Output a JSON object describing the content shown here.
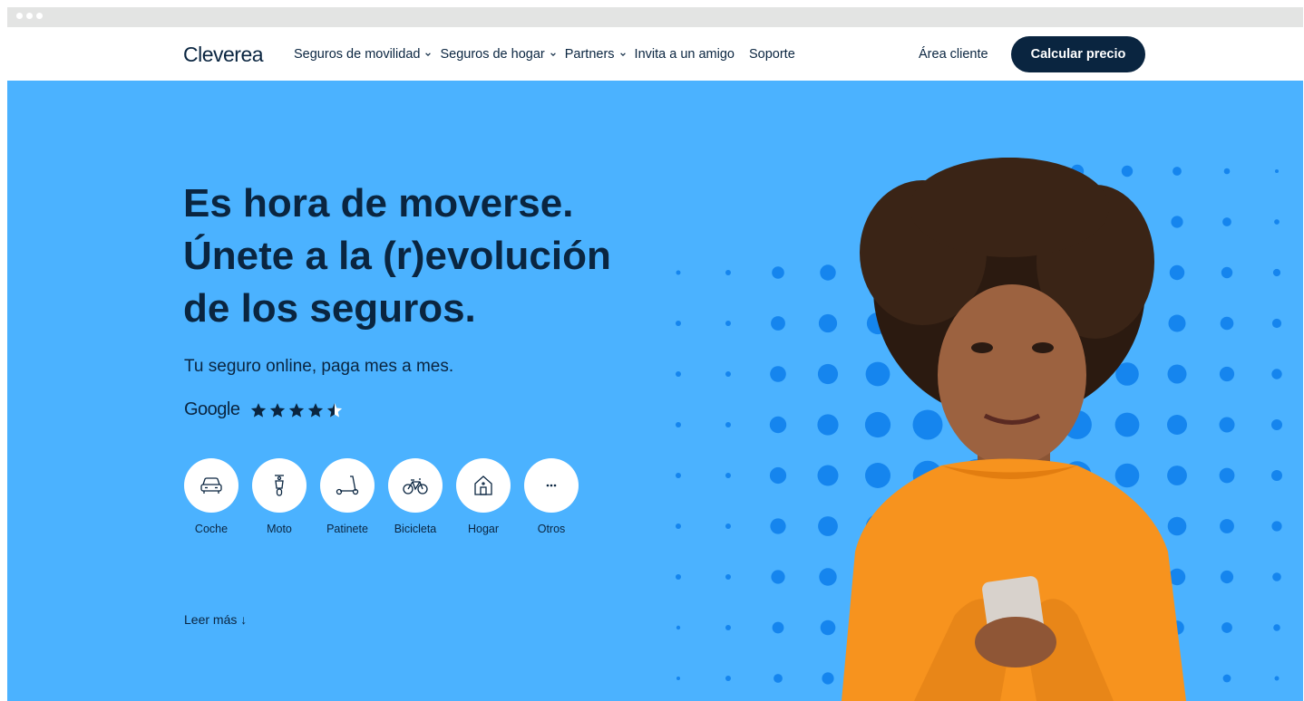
{
  "nav": {
    "logo": "Cleverea",
    "menu": [
      {
        "label": "Seguros de movilidad",
        "dropdown": true
      },
      {
        "label": "Seguros de hogar",
        "dropdown": true
      },
      {
        "label": "Partners",
        "dropdown": true
      },
      {
        "label": "Invita a un amigo",
        "dropdown": false
      },
      {
        "label": "Soporte",
        "dropdown": false
      }
    ],
    "client_area": "Área cliente",
    "cta": "Calcular precio"
  },
  "hero": {
    "headline": [
      "Es hora de moverse.",
      "Únete a la (r)evolución",
      "de los seguros."
    ],
    "subtitle": "Tu seguro online, paga mes a mes.",
    "rating_source": "Google",
    "rating_stars": 4.5,
    "categories": [
      {
        "label": "Coche",
        "icon": "car-icon"
      },
      {
        "label": "Moto",
        "icon": "scooter-icon"
      },
      {
        "label": "Patinete",
        "icon": "kick-scooter-icon"
      },
      {
        "label": "Bicicleta",
        "icon": "bicycle-icon"
      },
      {
        "label": "Hogar",
        "icon": "house-icon"
      },
      {
        "label": "Otros",
        "icon": "more-dots-icon"
      }
    ],
    "read_more": "Leer más ↓"
  },
  "colors": {
    "brand_dark": "#0a2540",
    "hero_bg": "#4bb2ff",
    "dots": "#1585ee",
    "sweater": "#f7931e"
  }
}
